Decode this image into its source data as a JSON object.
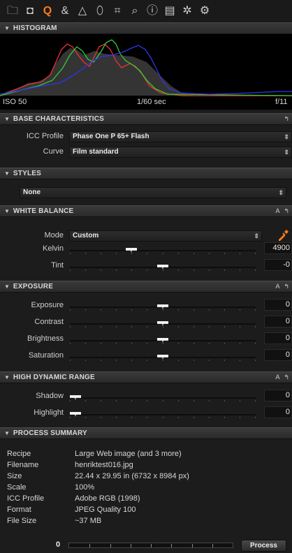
{
  "toolbar": {
    "icons": [
      "folder-icon",
      "camera-icon",
      "quick-search-icon",
      "color-icon",
      "exposure-icon",
      "lens-icon",
      "crop-icon",
      "details-icon",
      "info-icon",
      "metadata-icon",
      "settings-icon",
      "batch-icon"
    ],
    "glyphs": [
      "🗀",
      "◘",
      "Q",
      "&",
      "△",
      "⬯",
      "⌗",
      "⌕",
      "ⓘ",
      "▤",
      "✲",
      "⚙"
    ],
    "active_index": 2,
    "accent": "#ff7a1a"
  },
  "histogram": {
    "title": "HISTOGRAM",
    "iso": "ISO 50",
    "shutter": "1/60 sec",
    "aperture": "f/11"
  },
  "base": {
    "title": "BASE CHARACTERISTICS",
    "icc_label": "ICC Profile",
    "icc_value": "Phase One P 65+ Flash",
    "curve_label": "Curve",
    "curve_value": "Film standard"
  },
  "styles": {
    "title": "STYLES",
    "value": "None"
  },
  "white_balance": {
    "title": "WHITE BALANCE",
    "mode_label": "Mode",
    "mode_value": "Custom",
    "kelvin_label": "Kelvin",
    "kelvin_value": "4900",
    "kelvin_pos": 0.32,
    "tint_label": "Tint",
    "tint_value": "-0",
    "tint_pos": 0.5
  },
  "exposure": {
    "title": "EXPOSURE",
    "rows": [
      {
        "label": "Exposure",
        "value": "0",
        "pos": 0.5
      },
      {
        "label": "Contrast",
        "value": "0",
        "pos": 0.5
      },
      {
        "label": "Brightness",
        "value": "0",
        "pos": 0.5
      },
      {
        "label": "Saturation",
        "value": "0",
        "pos": 0.5
      }
    ]
  },
  "hdr": {
    "title": "HIGH DYNAMIC RANGE",
    "rows": [
      {
        "label": "Shadow",
        "value": "0",
        "pos": 0.0
      },
      {
        "label": "Highlight",
        "value": "0",
        "pos": 0.0
      }
    ]
  },
  "summary": {
    "title": "PROCESS SUMMARY",
    "rows": [
      {
        "k": "Recipe",
        "v": "Large Web image (and 3 more)"
      },
      {
        "k": "Filename",
        "v": "henriktest016.jpg"
      },
      {
        "k": "Size",
        "v": "22.44 x 29.95 in (6732 x 8984 px)"
      },
      {
        "k": "Scale",
        "v": "100%"
      },
      {
        "k": "ICC Profile",
        "v": "Adobe RGB (1998)"
      },
      {
        "k": "Format",
        "v": "JPEG Quality 100"
      },
      {
        "k": "File Size",
        "v": "~37 MB"
      }
    ]
  },
  "process": {
    "count": "0",
    "button": "Process"
  },
  "header_controls": {
    "auto": "A",
    "reset": "↰"
  }
}
